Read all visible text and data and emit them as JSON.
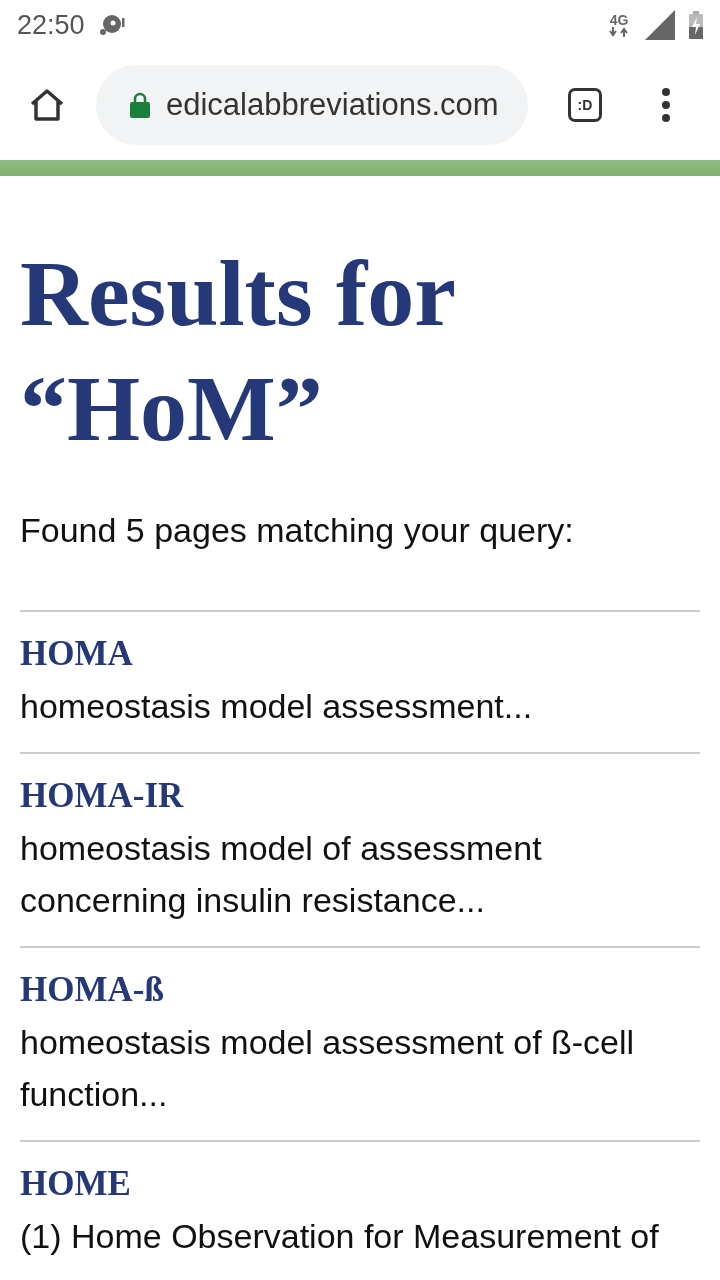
{
  "status_bar": {
    "time": "22:50",
    "network": "4G"
  },
  "browser": {
    "url": "edicalabbreviations.com",
    "tab_switcher": ":D"
  },
  "page": {
    "title": "Results for “HoM”",
    "summary": "Found 5 pages matching your query:",
    "results": [
      {
        "term": "HOMA",
        "description": "homeostasis model assessment..."
      },
      {
        "term": "HOMA-IR",
        "description": "homeostasis model of assessment concerning insulin resistance..."
      },
      {
        "term": "HOMA-ß",
        "description": "homeostasis model assessment of ß-cell function..."
      },
      {
        "term": "HOME",
        "description": "(1) Home Observation for Measurement of"
      }
    ]
  }
}
